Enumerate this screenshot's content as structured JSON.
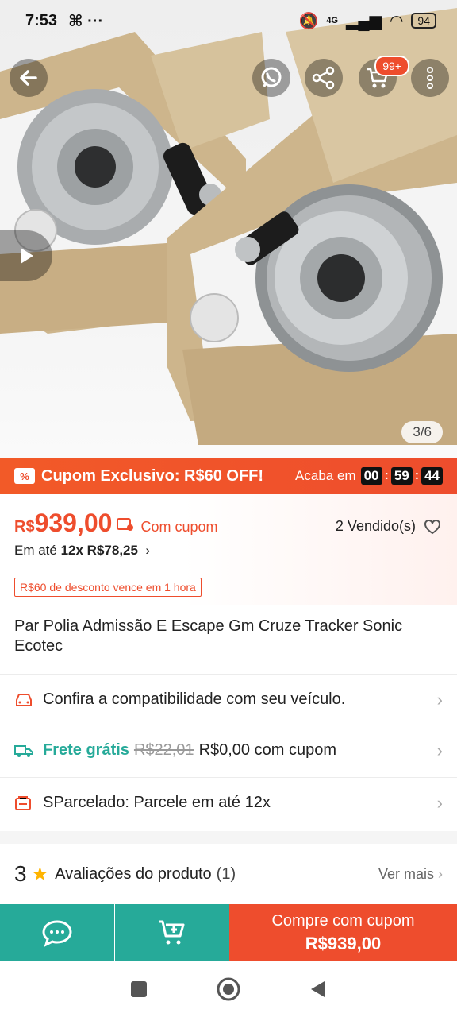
{
  "status": {
    "time": "7:53",
    "battery": "94",
    "network": "4G"
  },
  "gallery": {
    "counter": "3/6",
    "cart_badge": "99+"
  },
  "coupon": {
    "title": "Cupom Exclusivo: R$60 OFF!",
    "ends_label": "Acaba em",
    "hh": "00",
    "mm": "59",
    "ss": "44"
  },
  "price": {
    "currency": "R$",
    "amount": "939,00",
    "with_coupon": "Com cupom",
    "installment_prefix": "Em até",
    "installment": "12x R$78,25",
    "sold": "2 Vendido(s)",
    "expire_tag": "R$60 de desconto vence em 1 hora"
  },
  "product": {
    "title": "Par Polia Admissão E Escape Gm Cruze Tracker Sonic Ecotec"
  },
  "rows": {
    "compat": "Confira a compatibilidade com seu veículo.",
    "shipping_label": "Frete grátis",
    "shipping_old": "R$22,01",
    "shipping_new": "R$0,00 com cupom",
    "parcel": "SParcelado: Parcele em até 12x"
  },
  "reviews": {
    "rating": "3",
    "label": "Avaliações do produto",
    "count": "(1)",
    "more": "Ver mais"
  },
  "bottom": {
    "buy_line1": "Compre com cupom",
    "buy_line2": "R$939,00"
  },
  "colors": {
    "brand": "#ee4d2d",
    "teal": "#26aa99"
  }
}
